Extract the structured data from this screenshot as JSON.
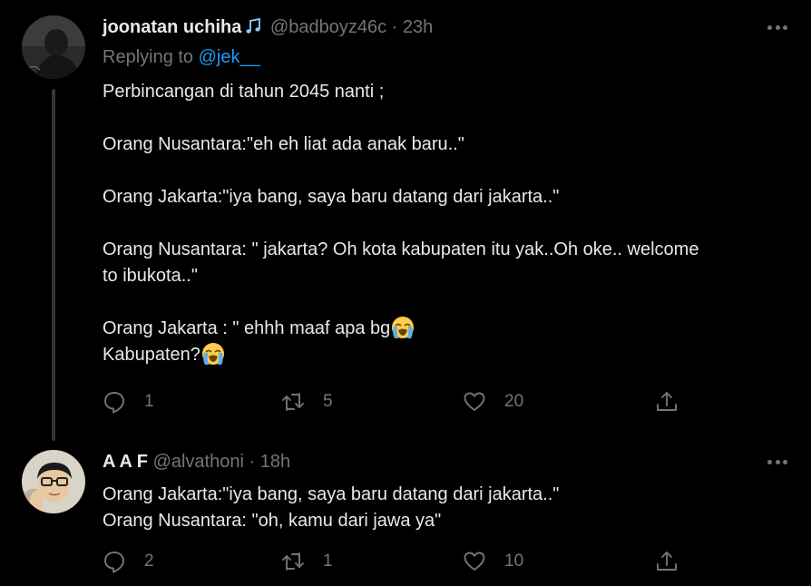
{
  "tweets": [
    {
      "author_name": "joonatan uchiha",
      "handle": "@badboyz46c",
      "separator": "·",
      "time": "23h",
      "replying_prefix": "Replying to ",
      "replying_to": "@jek__",
      "lines": [
        "Perbincangan di tahun 2045 nanti ;",
        "",
        "Orang Nusantara:\"eh eh liat ada anak baru..\"",
        "",
        "Orang Jakarta:\"iya bang, saya baru datang dari jakarta..\"",
        "",
        "Orang Nusantara: \" jakarta? Oh kota kabupaten itu yak..Oh oke.. welcome",
        "to ibukota..\"",
        "",
        "Orang Jakarta : \" ehhh maaf apa bg",
        "Kabupaten?"
      ],
      "emoji": "loudly-crying-face",
      "counts": {
        "reply": "1",
        "retweet": "5",
        "like": "20"
      }
    },
    {
      "author_name": "A A F",
      "handle": "@alvathoni",
      "separator": "·",
      "time": "18h",
      "lines": [
        "Orang Jakarta:\"iya bang, saya baru datang dari jakarta..\"",
        "Orang Nusantara: \"oh, kamu dari jawa ya\""
      ],
      "counts": {
        "reply": "2",
        "retweet": "1",
        "like": "10"
      }
    }
  ],
  "colors": {
    "background": "#000000",
    "text": "#e7e9ea",
    "muted": "#71767b",
    "link": "#1d9bf0",
    "thread_line": "#333639"
  }
}
